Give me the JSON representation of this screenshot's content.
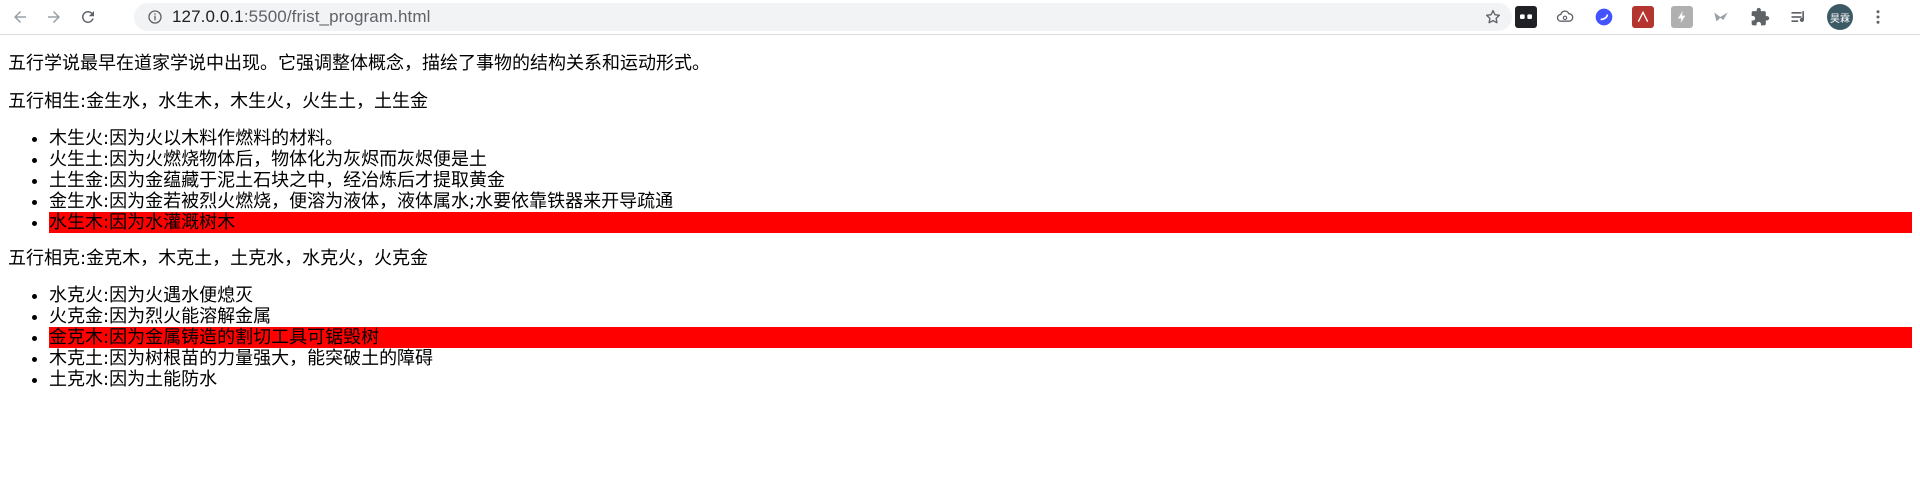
{
  "browser": {
    "url_host": "127.0.0.1",
    "url_path": ":5500/frist_program.html",
    "avatar_text": "昊霖"
  },
  "content": {
    "intro": "五行学说最早在道家学说中出现。它强调整体概念，描绘了事物的结构关系和运动形式。",
    "sheng_title": "五行相生:金生水，水生木，木生火，火生土，土生金",
    "sheng_items": [
      "木生火:因为火以木料作燃料的材料。",
      "火生土:因为火燃烧物体后，物体化为灰烬而灰烬便是土",
      "土生金:因为金蕴藏于泥土石块之中，经冶炼后才提取黄金",
      "金生水:因为金若被烈火燃烧，便溶为液体，液体属水;水要依靠铁器来开导疏通",
      "水生木:因为水灌溉树木"
    ],
    "ke_title": "五行相克:金克木，木克土，土克水，水克火，火克金",
    "ke_items": [
      "水克火:因为火遇水便熄灭",
      "火克金:因为烈火能溶解金属",
      "金克木:因为金属铸造的割切工具可锯毁树",
      "木克土:因为树根苗的力量强大，能突破土的障碍",
      "土克水:因为土能防水"
    ],
    "highlight_color": "#ff0000"
  }
}
